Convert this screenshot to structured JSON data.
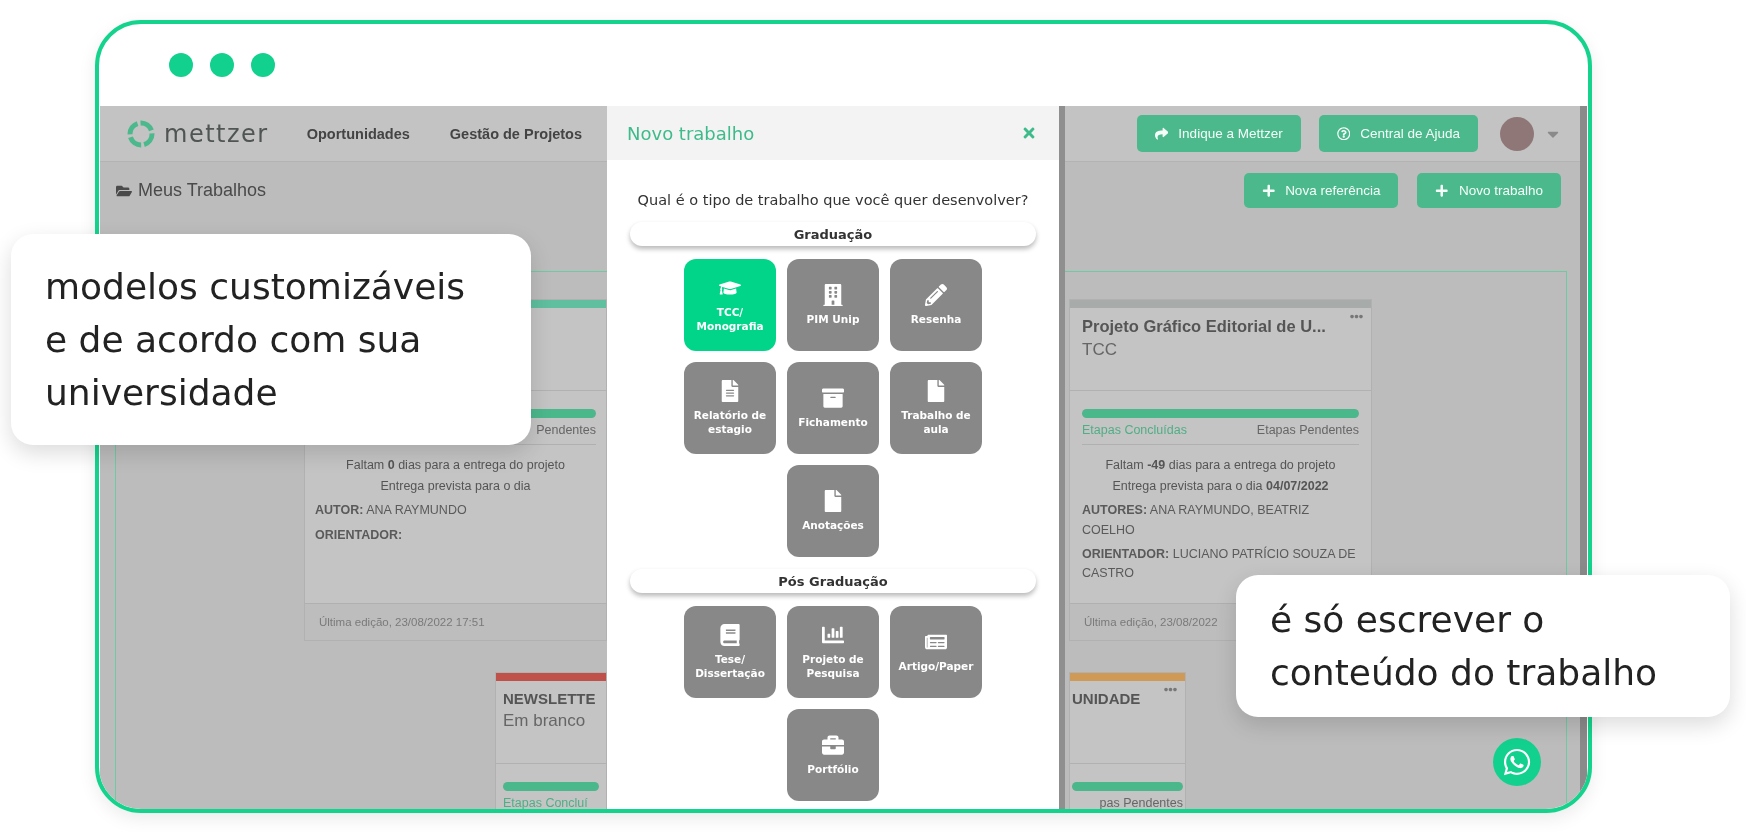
{
  "navbar": {
    "logo": "mettzer",
    "links": [
      "Oportunidades",
      "Gestão de Projetos"
    ],
    "buttons": [
      "Indique a Mettzer",
      "Central de Ajuda"
    ]
  },
  "page_header": {
    "title": "Meus Trabalhos",
    "buttons": [
      "Nova referência",
      "Novo trabalho"
    ]
  },
  "cards": [
    {
      "color": "#5fbf9f",
      "level": 1,
      "pending": "Pendentes",
      "deadline": "Faltam **0** dias para a entrega do projeto",
      "due": "Entrega prevista para o dia",
      "people": [
        "**AUTOR:** ANA RAYMUNDO",
        "**ORIENTADOR:**"
      ],
      "footer": "Última edição, 23/08/2022 17:51"
    },
    {
      "color": "#a7aba9",
      "menu": true,
      "title": "Projeto Gráfico Editorial de U...",
      "subtitle": "TCC",
      "level": 1,
      "completed": "Etapas Concluídas",
      "pending": "Etapas Pendentes",
      "deadline": "Faltam **-49** dias para a entrega do projeto",
      "due": "Entrega prevista para o dia **04/07/2022**",
      "people": [
        "**AUTORES:** ANA RAYMUNDO, BEATRIZ COELHO",
        "**ORIENTADOR:** LUCIANO PATRÍCIO SOUZA DE CASTRO"
      ],
      "footer": "Última edição, 23/08/2022"
    },
    {
      "color": "#c0504a",
      "title": "NEWSLETTE",
      "subtitle": "Em branco",
      "level": 1,
      "completed": "Etapas Concluí"
    },
    {
      "color": "#cf9a55",
      "menu": true,
      "title": "UNIDADE",
      "level": 1,
      "pending": "pas Pendentes"
    }
  ],
  "modal": {
    "title": "Novo trabalho",
    "question": "Qual é o tipo de trabalho que você quer desenvolver?",
    "sections": [
      {
        "title": "Graduação",
        "options": [
          {
            "label": "TCC/ Monografia",
            "selected": true
          },
          {
            "label": "PIM Unip",
            "selected": false
          },
          {
            "label": "Resenha",
            "selected": false
          },
          {
            "label": "Relatório de estagio",
            "selected": false
          },
          {
            "label": "Fichamento",
            "selected": false
          },
          {
            "label": "Trabalho de aula",
            "selected": false
          },
          {
            "label": "Anotações",
            "selected": false
          }
        ]
      },
      {
        "title": "Pós Graduação",
        "options": [
          {
            "label": "Tese/ Dissertação",
            "selected": false
          },
          {
            "label": "Projeto de Pesquisa",
            "selected": false
          },
          {
            "label": "Artigo/Paper",
            "selected": false
          },
          {
            "label": "Portfólio",
            "selected": false
          }
        ]
      }
    ]
  },
  "callouts": [
    "modelos customizáveis e de acordo com sua universidade",
    "é só escrever o conteúdo do trabalho"
  ]
}
